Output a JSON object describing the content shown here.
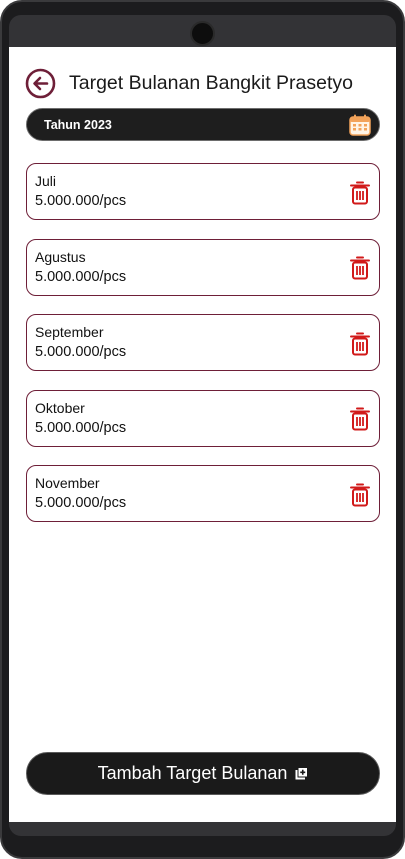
{
  "header": {
    "title": "Target Bulanan Bangkit Prasetyo",
    "back_icon": "arrow-left-circle-icon"
  },
  "year_filter": {
    "label": "Tahun 2023",
    "icon": "calendar-icon"
  },
  "targets": [
    {
      "month": "Juli",
      "value": "5.000.000/pcs"
    },
    {
      "month": "Agustus",
      "value": "5.000.000/pcs"
    },
    {
      "month": "September",
      "value": "5.000.000/pcs"
    },
    {
      "month": "Oktober",
      "value": "5.000.000/pcs"
    },
    {
      "month": "November",
      "value": "5.000.000/pcs"
    }
  ],
  "add_button": {
    "label": "Tambah Target Bulanan",
    "icon": "add-box-icon"
  },
  "colors": {
    "accent": "#6e1f38",
    "delete": "#d11a1a",
    "dark": "#1a1a1a",
    "calendar": "#f3a35a"
  }
}
